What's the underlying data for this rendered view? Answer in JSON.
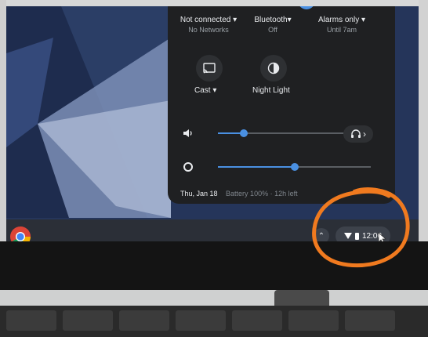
{
  "quick_settings": {
    "wifi": {
      "title": "Not connected ▾",
      "subtitle": "No Networks",
      "icon": "wifi-icon"
    },
    "bluetooth": {
      "title": "Bluetooth▾",
      "subtitle": "Off",
      "icon": "bluetooth-icon"
    },
    "notifications": {
      "title": "Alarms only ▾",
      "subtitle": "Until 7am",
      "icon": "bell-icon"
    },
    "cast": {
      "label": "Cast ▾",
      "icon": "cast-icon"
    },
    "night_light": {
      "label": "Night Light",
      "icon": "night-light-icon"
    },
    "volume": {
      "icon": "speaker-icon",
      "level": 0.17
    },
    "brightness": {
      "icon": "brightness-icon",
      "level": 0.5
    },
    "audio_settings": {
      "icon": "headphones-icon"
    },
    "footer": {
      "date": "Thu, Jan 18",
      "battery": "Battery 100% · 12h left"
    }
  },
  "shelf": {
    "chrome": {
      "icon": "chrome-icon"
    },
    "tray": {
      "time": "12:00",
      "wifi_icon": "wifi-icon",
      "battery_icon": "battery-icon"
    }
  },
  "colors": {
    "accent": "#4a90e2",
    "panel": "#1f2022",
    "annotation": "#f07a1f"
  }
}
